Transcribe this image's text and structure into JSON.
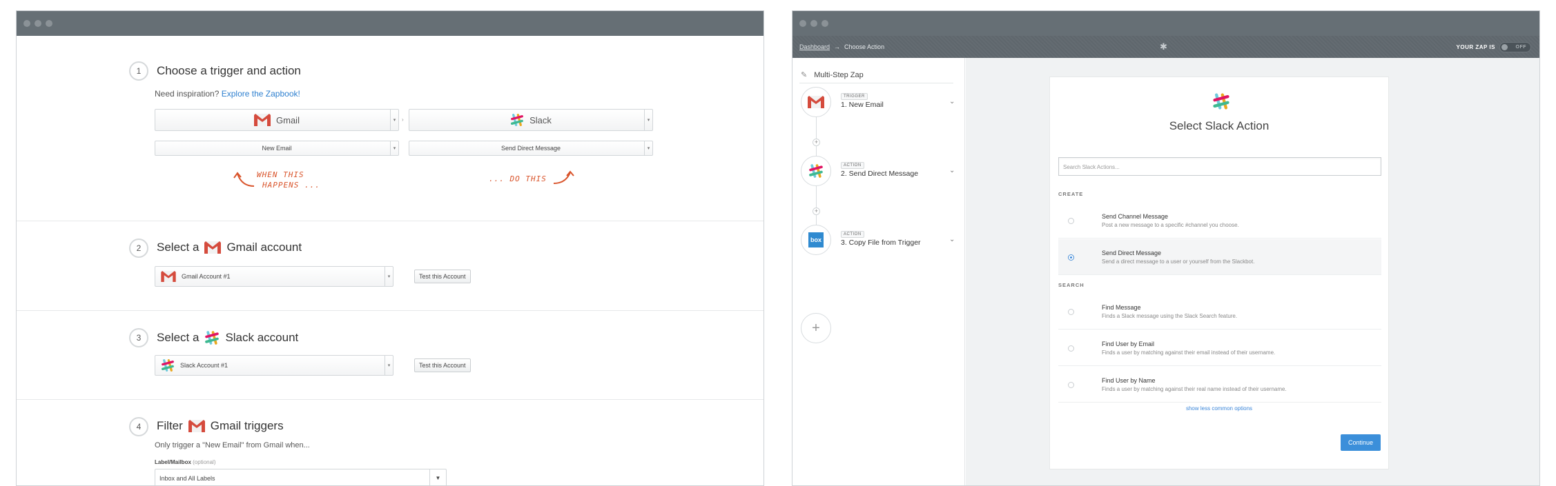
{
  "left_window": {
    "step1": {
      "number": "1",
      "title": "Choose a trigger and action",
      "inspiration_prefix": "Need inspiration?",
      "inspiration_link": "Explore the Zapbook!",
      "trigger_app": "Gmail",
      "action_app": "Slack",
      "trigger_event": "New Email",
      "action_event": "Send Direct Message",
      "hint_left_line1": "When this",
      "hint_left_line2": "happens ...",
      "hint_right": "... do this"
    },
    "step2": {
      "number": "2",
      "title_prefix": "Select a",
      "title_suffix": "Gmail account",
      "account": "Gmail Account #1",
      "test_label": "Test this Account"
    },
    "step3": {
      "number": "3",
      "title_prefix": "Select a",
      "title_suffix": "Slack account",
      "account": "Slack Account #1",
      "test_label": "Test this Account"
    },
    "step4": {
      "number": "4",
      "title_prefix": "Filter",
      "title_suffix": "Gmail triggers",
      "description": "Only trigger a \"New Email\" from Gmail when...",
      "field_label": "Label/Mailbox",
      "field_optional": "(optional)",
      "field_value": "Inbox and All Labels"
    }
  },
  "right_window": {
    "breadcrumb": {
      "dashboard": "Dashboard",
      "arrow": "→",
      "current": "Choose Action"
    },
    "zap_status_label": "YOUR ZAP IS",
    "zap_status_value": "OFF",
    "sidebar": {
      "title": "Multi-Step Zap",
      "steps": [
        {
          "tag": "TRIGGER",
          "title": "1. New Email"
        },
        {
          "tag": "ACTION",
          "title": "2. Send Direct Message"
        },
        {
          "tag": "ACTION",
          "title": "3. Copy File from Trigger"
        }
      ],
      "box_icon_text": "box"
    },
    "card": {
      "title": "Select Slack Action",
      "search_placeholder": "Search Slack Actions...",
      "create_header": "CREATE",
      "search_header": "SEARCH",
      "options": [
        {
          "name": "Send Channel Message",
          "desc": "Post a new message to a specific #channel you choose.",
          "selected": false
        },
        {
          "name": "Send Direct Message",
          "desc": "Send a direct message to a user or yourself from the Slackbot.",
          "selected": true
        },
        {
          "name": "Find Message",
          "desc": "Finds a Slack message using the Slack Search feature.",
          "selected": false
        },
        {
          "name": "Find User by Email",
          "desc": "Finds a user by matching against their email instead of their username.",
          "selected": false
        },
        {
          "name": "Find User by Name",
          "desc": "Finds a user by matching against their real name instead of their username.",
          "selected": false
        }
      ],
      "show_less": "show less common options",
      "continue_label": "Continue"
    }
  },
  "colors": {
    "titlebar": "#666f75",
    "link": "#2d7fcf",
    "accent_orange": "#d9542b",
    "primary_button": "#3b8fda"
  }
}
